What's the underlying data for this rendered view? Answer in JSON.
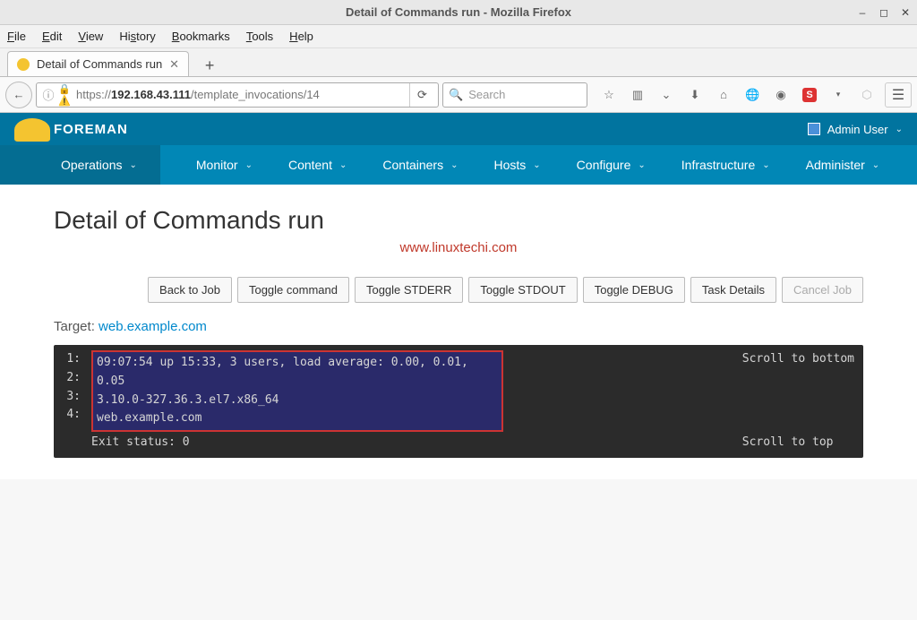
{
  "window": {
    "title": "Detail of Commands run - Mozilla Firefox"
  },
  "menubar": {
    "file": "File",
    "edit": "Edit",
    "view": "View",
    "history": "History",
    "bookmarks": "Bookmarks",
    "tools": "Tools",
    "help": "Help"
  },
  "tab": {
    "title": "Detail of Commands run"
  },
  "url": {
    "scheme": "https://",
    "host": "192.168.43.111",
    "path": "/template_invocations/14",
    "full": "https://192.168.43.111/template_invocations/14"
  },
  "search_placeholder": "Search",
  "foreman": {
    "brand": "FOREMAN",
    "user": "Admin User",
    "nav": {
      "operations": "Operations",
      "monitor": "Monitor",
      "content": "Content",
      "containers": "Containers",
      "hosts": "Hosts",
      "configure": "Configure",
      "infrastructure": "Infrastructure",
      "administer": "Administer"
    }
  },
  "page": {
    "heading": "Detail of Commands run",
    "watermark": "www.linuxtechi.com",
    "buttons": {
      "back": "Back to Job",
      "tcmd": "Toggle command",
      "tstderr": "Toggle STDERR",
      "tstdout": "Toggle STDOUT",
      "tdebug": "Toggle DEBUG",
      "taskdetails": "Task Details",
      "cancel": "Cancel Job"
    },
    "target_label": "Target: ",
    "target_host": "web.example.com"
  },
  "terminal": {
    "lines": [
      {
        "n": "1:",
        "text": " 09:07:54 up 15:33, 3 users, load average: 0.00, 0.01, 0.05",
        "hl": true
      },
      {
        "n": "2:",
        "text": "3.10.0-327.36.3.el7.x86_64",
        "hl": true
      },
      {
        "n": "3:",
        "text": "web.example.com",
        "hl": true
      },
      {
        "n": "4:",
        "text": "Exit status: 0",
        "hl": false
      }
    ],
    "scroll_bottom": "Scroll to bottom",
    "scroll_top": "Scroll to top"
  }
}
